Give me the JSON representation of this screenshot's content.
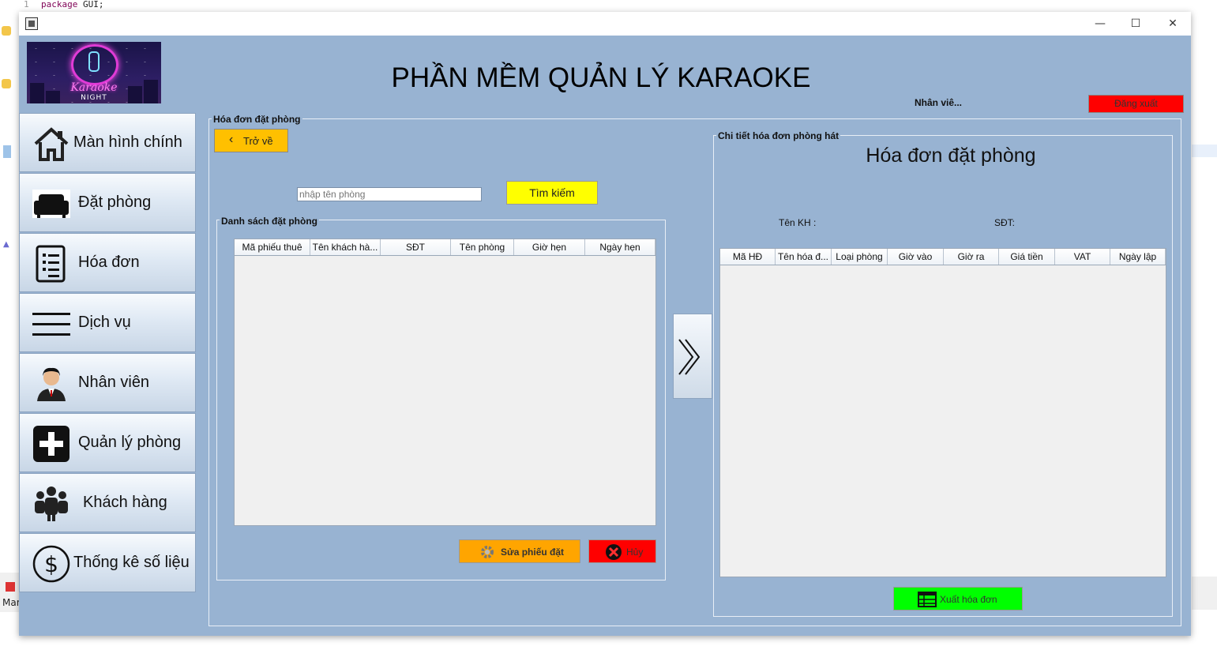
{
  "ide": {
    "line_number": "1",
    "code_keyword": "package",
    "code_name": "GUI;",
    "bottom_label": "Mar"
  },
  "window": {
    "controls": [
      "—",
      "☐",
      "✕"
    ]
  },
  "header": {
    "logo_text": "Karaoke",
    "logo_subtext": "NIGHT",
    "title": "PHẦN MỀM QUẢN LÝ KARAOKE",
    "employee_label": "Nhân viê...",
    "logout_label": "Đăng xuất"
  },
  "sidebar": {
    "items": [
      {
        "label": "Màn hình chính",
        "icon": "home-icon"
      },
      {
        "label": "Đặt phòng",
        "icon": "sofa-icon"
      },
      {
        "label": "Hóa đơn",
        "icon": "receipt-icon"
      },
      {
        "label": "Dịch vụ",
        "icon": "menu-lines-icon"
      },
      {
        "label": "Nhân viên",
        "icon": "employee-icon"
      },
      {
        "label": "Quản lý phòng",
        "icon": "plus-square-icon"
      },
      {
        "label": "Khách hàng",
        "icon": "group-icon"
      },
      {
        "label": "Thống kê số liệu",
        "icon": "dollar-circle-icon"
      }
    ]
  },
  "main": {
    "group_title": "Hóa đơn đặt phòng",
    "back_label": "Trở về",
    "search_placeholder": "nhập tên phòng",
    "search_button": "Tìm kiếm",
    "booking_list": {
      "title": "Danh sách đặt phòng",
      "columns": [
        "Mã phiếu thuê",
        "Tên khách hà...",
        "SĐT",
        "Tên phòng",
        "Giờ hẹn",
        "Ngày hẹn"
      ]
    },
    "edit_button": "Sửa phiếu đặt",
    "cancel_button": "Hủy",
    "detail": {
      "group_title": "Chi tiết hóa đơn phòng hát",
      "title": "Hóa đơn đặt phòng",
      "customer_label": "Tên KH :",
      "phone_label": "SĐT:",
      "columns": [
        "Mã HĐ",
        "Tên hóa đ...",
        "Loại phòng",
        "Giờ vào",
        "Giờ ra",
        "Giá tiền",
        "VAT",
        "Ngày lập"
      ],
      "export_button": "Xuất hóa đơn"
    }
  },
  "colors": {
    "window_bg": "#98b3d2",
    "logout_bg": "#ff0000",
    "back_bg": "#ffc000",
    "search_bg": "#ffff00",
    "edit_bg": "#ffa500",
    "export_bg": "#00ff00"
  }
}
